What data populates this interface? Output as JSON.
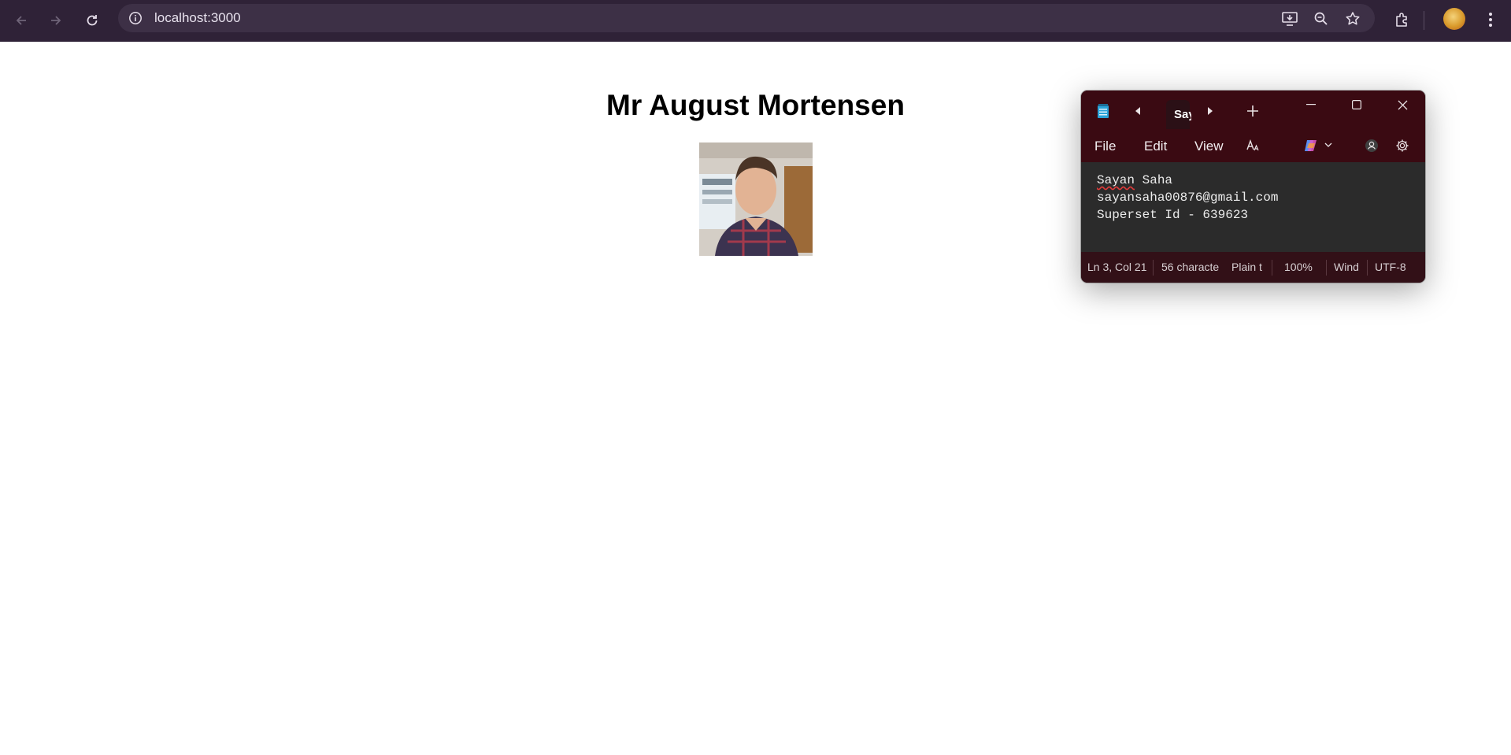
{
  "browser": {
    "url": "localhost:3000",
    "icons": {
      "back": "back-arrow-icon",
      "forward": "forward-arrow-icon",
      "reload": "reload-icon",
      "site_info": "info-icon",
      "install": "install-app-icon",
      "zoom": "zoom-icon",
      "bookmark": "star-icon",
      "extensions": "puzzle-icon",
      "menu": "kebab-menu-icon"
    },
    "colors": {
      "toolbar_bg": "#2f2237",
      "omnibox_bg": "#3d3046"
    }
  },
  "page": {
    "heading": "Mr August Mortensen"
  },
  "notepad": {
    "tab_title": "Say",
    "menu": {
      "file": "File",
      "edit": "Edit",
      "view": "View"
    },
    "content": {
      "line1_word1": "Sayan",
      "line1_rest": " Saha",
      "line2": "sayansaha00876@gmail.com",
      "line3": "Superset Id - 639623"
    },
    "status": {
      "position": "Ln 3, Col 21",
      "characters": "56 characte",
      "format": "Plain t",
      "zoom": "100%",
      "line_ending": "Wind",
      "encoding": "UTF-8"
    },
    "colors": {
      "titlebar_bg": "#3a0a12",
      "editor_bg": "#2b2b2b"
    }
  }
}
